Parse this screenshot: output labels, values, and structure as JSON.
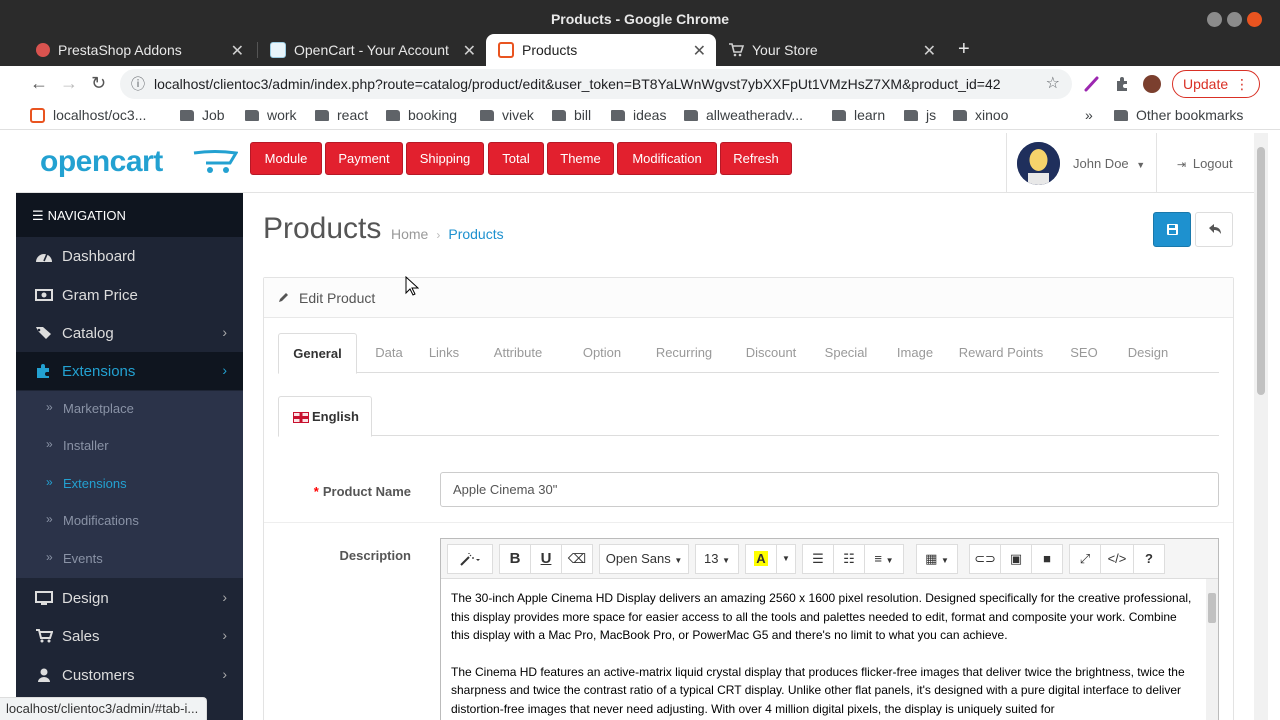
{
  "window": {
    "title": "Products - Google Chrome"
  },
  "tabs": [
    {
      "label": "PrestaShop Addons"
    },
    {
      "label": "OpenCart - Your Account"
    },
    {
      "label": "Products"
    },
    {
      "label": "Your Store"
    }
  ],
  "omnibox": {
    "url": "localhost/clientoc3/admin/index.php?route=catalog/product/edit&user_token=BT8YaLWnWgvst7ybXXFpUt1VMzHsZ7XM&product_id=42"
  },
  "browser": {
    "update_label": "Update"
  },
  "bookmarks": {
    "items": [
      "localhost/oc3...",
      "Job",
      "work",
      "react",
      "booking",
      "vivek",
      "bill",
      "ideas",
      "allweatheradv...",
      "learn",
      "js",
      "xinoo"
    ],
    "overflow": "»",
    "other": "Other bookmarks"
  },
  "header": {
    "logo": "opencart",
    "buttons": [
      "Module",
      "Payment",
      "Shipping",
      "Total",
      "Theme",
      "Modification",
      "Refresh"
    ],
    "user_name": "John Doe",
    "logout": "Logout"
  },
  "sidebar": {
    "heading": "NAVIGATION",
    "items": [
      {
        "label": "Dashboard",
        "icon": "dashboard-icon"
      },
      {
        "label": "Gram Price",
        "icon": "money-icon"
      },
      {
        "label": "Catalog",
        "icon": "tags-icon"
      },
      {
        "label": "Extensions",
        "icon": "puzzle-icon"
      },
      {
        "label": "Design",
        "icon": "monitor-icon"
      },
      {
        "label": "Sales",
        "icon": "cart-icon"
      },
      {
        "label": "Customers",
        "icon": "user-icon"
      }
    ],
    "subitems": [
      "Marketplace",
      "Installer",
      "Extensions",
      "Modifications",
      "Events"
    ]
  },
  "statusbar": {
    "text": "localhost/clientoc3/admin/#tab-i..."
  },
  "content": {
    "title": "Products",
    "breadcrumb": {
      "home": "Home",
      "current": "Products"
    },
    "panel_title": "Edit Product",
    "tabs": [
      "General",
      "Data",
      "Links",
      "Attribute",
      "Option",
      "Recurring",
      "Discount",
      "Special",
      "Image",
      "Reward Points",
      "SEO",
      "Design"
    ],
    "language_tab": "English",
    "product_name_label": "Product Name",
    "product_name_value": "Apple Cinema 30\"",
    "description_label": "Description",
    "editor": {
      "font": "Open Sans",
      "size": "13",
      "paragraphs": [
        "The 30-inch Apple Cinema HD Display delivers an amazing 2560 x 1600 pixel resolution. Designed specifically for the creative professional, this display provides more space for easier access to all the tools and palettes needed to edit, format and composite your work. Combine this display with a Mac Pro, MacBook Pro, or PowerMac G5 and there's no limit to what you can achieve.",
        "The Cinema HD features an active-matrix liquid crystal display that produces flicker-free images that deliver twice the brightness, twice the sharpness and twice the contrast ratio of a typical CRT display. Unlike other flat panels, it's designed with a pure digital interface to deliver distortion-free images that never need adjusting. With over 4 million digital pixels, the display is uniquely suited for"
      ]
    }
  },
  "colors": {
    "accent": "#1e91cf",
    "brand": "#23a1d1",
    "danger": "#e2202e",
    "sidebar": "#1e2535"
  }
}
